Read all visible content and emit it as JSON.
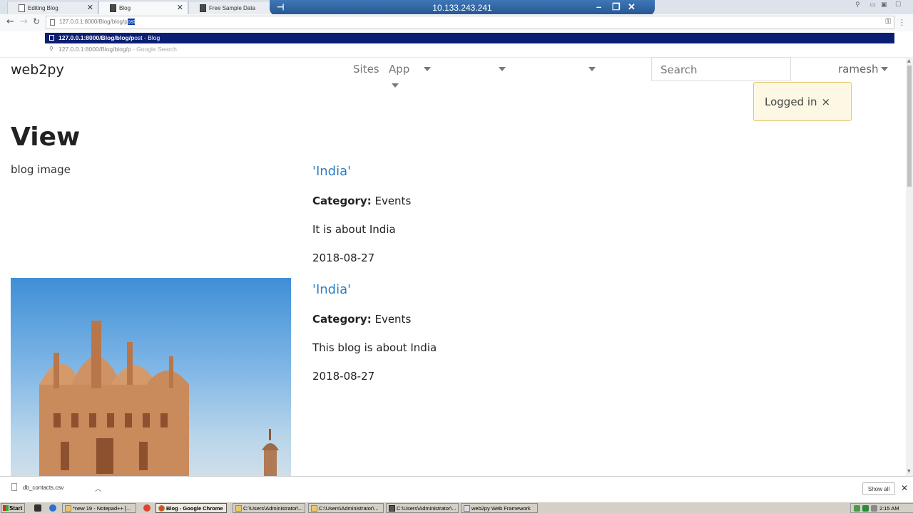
{
  "browser": {
    "tabs": [
      {
        "title": "Editing Blog",
        "state": "inactive"
      },
      {
        "title": "Blog",
        "state": "active"
      },
      {
        "title": "Free Sample Data",
        "state": "inactive"
      }
    ],
    "remote_session_ip": "10.133.243.241",
    "address": {
      "typed_prefix": "127.0.0.1:8000/Blog/blog/p",
      "selected_completion": "ost"
    },
    "suggestions": [
      {
        "bold": "127.0.0.1:8000/Blog/blog/p",
        "rest": "ost",
        "title": " - Blog"
      },
      {
        "text": "127.0.0.1:8000/Blog/blog/p",
        "hint": " - Google Search"
      }
    ]
  },
  "page": {
    "brand": "web2py",
    "nav": {
      "sites": "Sites",
      "app": "App"
    },
    "search_placeholder": "Search",
    "user": "ramesh",
    "flash": {
      "message": "Logged in",
      "close": "×"
    },
    "title": "View",
    "image_alt": "blog image",
    "posts": [
      {
        "title": "'India'",
        "category_label": "Category:",
        "category": " Events",
        "text": "It is about India",
        "date": "2018-08-27"
      },
      {
        "title": "'India'",
        "category_label": "Category:",
        "category": " Events",
        "text": "This blog is about India",
        "date": "2018-08-27"
      }
    ]
  },
  "downloads": {
    "file": "db_contacts.csv",
    "show_all": "Show all"
  },
  "taskbar": {
    "start": "Start",
    "tasks": [
      {
        "label": "*new 19 - Notepad++ [...",
        "active": false
      },
      {
        "label": "Blog - Google Chrome",
        "active": true
      },
      {
        "label": "C:\\Users\\Administrator\\...",
        "active": false
      },
      {
        "label": "C:\\Users\\Administrator\\...",
        "active": false
      },
      {
        "label": "C:\\Users\\Administrator\\...",
        "active": false
      },
      {
        "label": "web2py Web Framework",
        "active": false
      }
    ],
    "clock": "2:15 AM"
  }
}
